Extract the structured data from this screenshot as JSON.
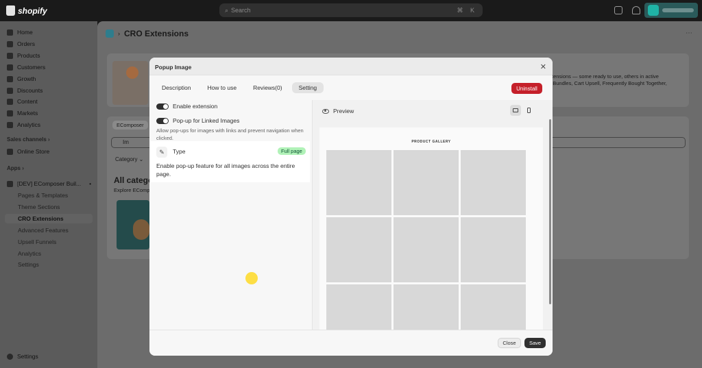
{
  "topbar": {
    "brand": "shopify",
    "search_placeholder": "Search",
    "search_shortcut": "⌘ K"
  },
  "sidebar": {
    "items": [
      {
        "label": "Home"
      },
      {
        "label": "Orders"
      },
      {
        "label": "Products"
      },
      {
        "label": "Customers"
      },
      {
        "label": "Growth"
      },
      {
        "label": "Discounts"
      },
      {
        "label": "Content"
      },
      {
        "label": "Markets"
      },
      {
        "label": "Analytics"
      }
    ],
    "sales_channels_heading": "Sales channels ›",
    "online_store": "Online Store",
    "apps_heading": "Apps ›",
    "app_name": "[DEV] EComposer Buil...",
    "app_subitems": [
      {
        "label": "Pages & Templates"
      },
      {
        "label": "Theme Sections"
      },
      {
        "label": "CRO Extensions"
      },
      {
        "label": "Advanced Features"
      },
      {
        "label": "Upsell Funnels"
      },
      {
        "label": "Analytics"
      },
      {
        "label": "Settings"
      }
    ],
    "settings": "Settings"
  },
  "page": {
    "title": "CRO Extensions",
    "bg_text_1": "tensions — some ready to use, others in active",
    "bg_text_2": "e Bundles, Cart Upsell, Frequently Bought Together,",
    "bg_tab": "EComposer",
    "bg_search_value": "Im",
    "bg_category": "Category ⌄",
    "bg_all_categories": "All catego",
    "bg_explore": "Explore EComp"
  },
  "modal": {
    "title": "Popup Image",
    "tabs": [
      {
        "label": "Description"
      },
      {
        "label": "How to use"
      },
      {
        "label": "Reviews(0)"
      },
      {
        "label": "Setting"
      }
    ],
    "uninstall_label": "Uninstall",
    "enable_extension": "Enable extension",
    "popup_linked": "Pop-up for Linked Images",
    "popup_linked_help": "Allow pop-ups for images with links and prevent navigation when clicked.",
    "type_label": "Type",
    "type_badge": "Full page",
    "type_desc": "Enable pop-up feature for all images across the entire page.",
    "preview_label": "Preview",
    "gallery_title": "PRODUCT GALLERY",
    "close_label": "Close",
    "save_label": "Save"
  },
  "colors": {
    "uninstall": "#c5202a",
    "badge_bg": "#b1f2b8",
    "badge_text": "#0c5132",
    "save_bg": "#303030",
    "cursor": "#ffd60a"
  }
}
